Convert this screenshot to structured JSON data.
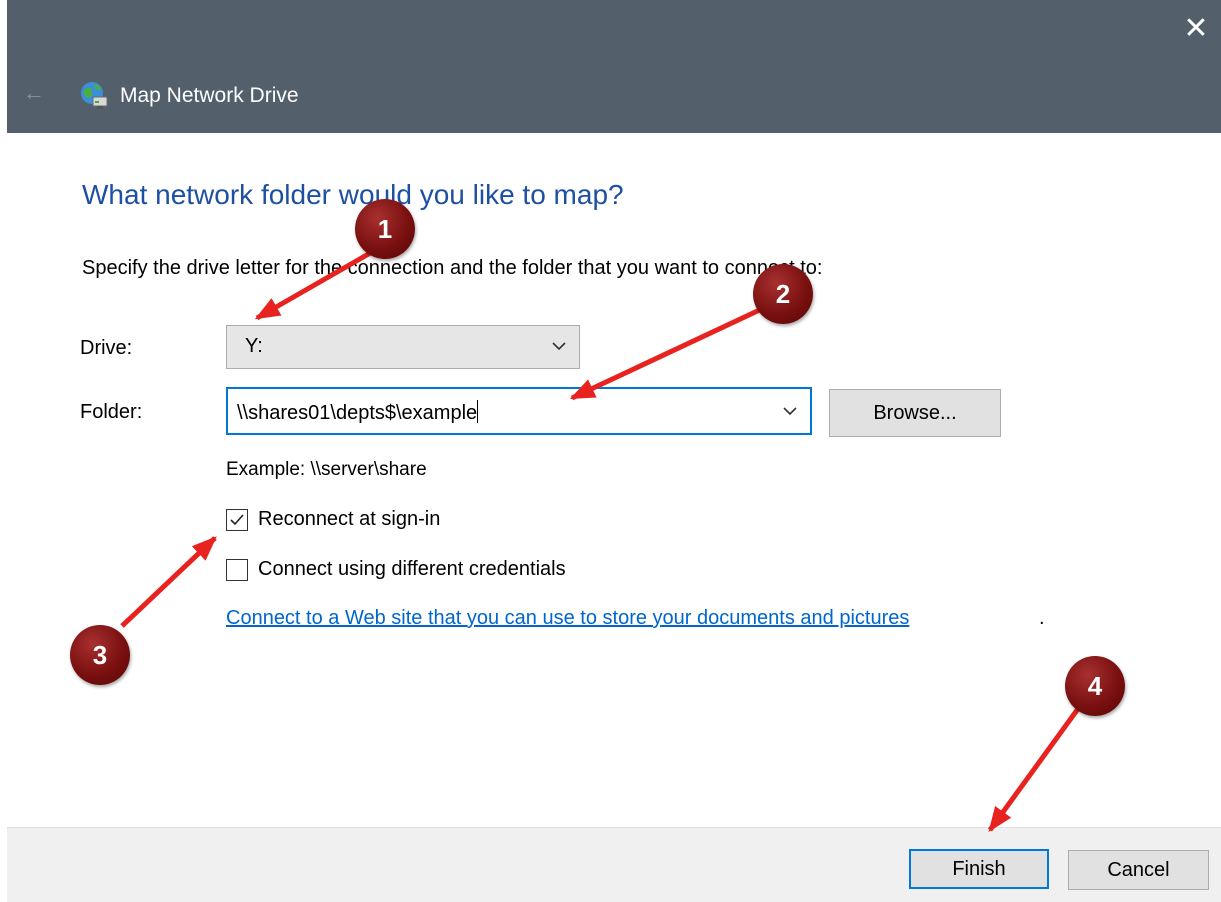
{
  "window": {
    "title": "Map Network Drive",
    "close_glyph": "✕",
    "back_glyph": "←"
  },
  "dialog": {
    "heading": "What network folder would you like to map?",
    "instruction": "Specify the drive letter for the connection and the folder that you want to connect to:",
    "drive_label": "Drive:",
    "drive_value": "Y:",
    "folder_label": "Folder:",
    "folder_value": "\\\\shares01\\depts$\\example",
    "browse_label": "Browse...",
    "example_text": "Example: \\\\server\\share",
    "reconnect_label": "Reconnect at sign-in",
    "reconnect_checked": true,
    "credentials_label": "Connect using different credentials",
    "credentials_checked": false,
    "web_link": "Connect to a Web site that you can use to store your documents and pictures",
    "web_link_suffix": "."
  },
  "footer": {
    "finish_label": "Finish",
    "cancel_label": "Cancel"
  },
  "annotations": {
    "badges": [
      "1",
      "2",
      "3",
      "4"
    ],
    "color": "#e8231f"
  },
  "colors": {
    "titlebar": "#545f6c",
    "heading": "#1e50a2",
    "accent": "#0078d7",
    "link": "#0066cc"
  },
  "icons": {
    "app": "network-drive-icon",
    "back": "back-arrow-icon",
    "close": "close-icon",
    "dropdown": "chevron-down-icon",
    "check": "checkmark-icon"
  }
}
